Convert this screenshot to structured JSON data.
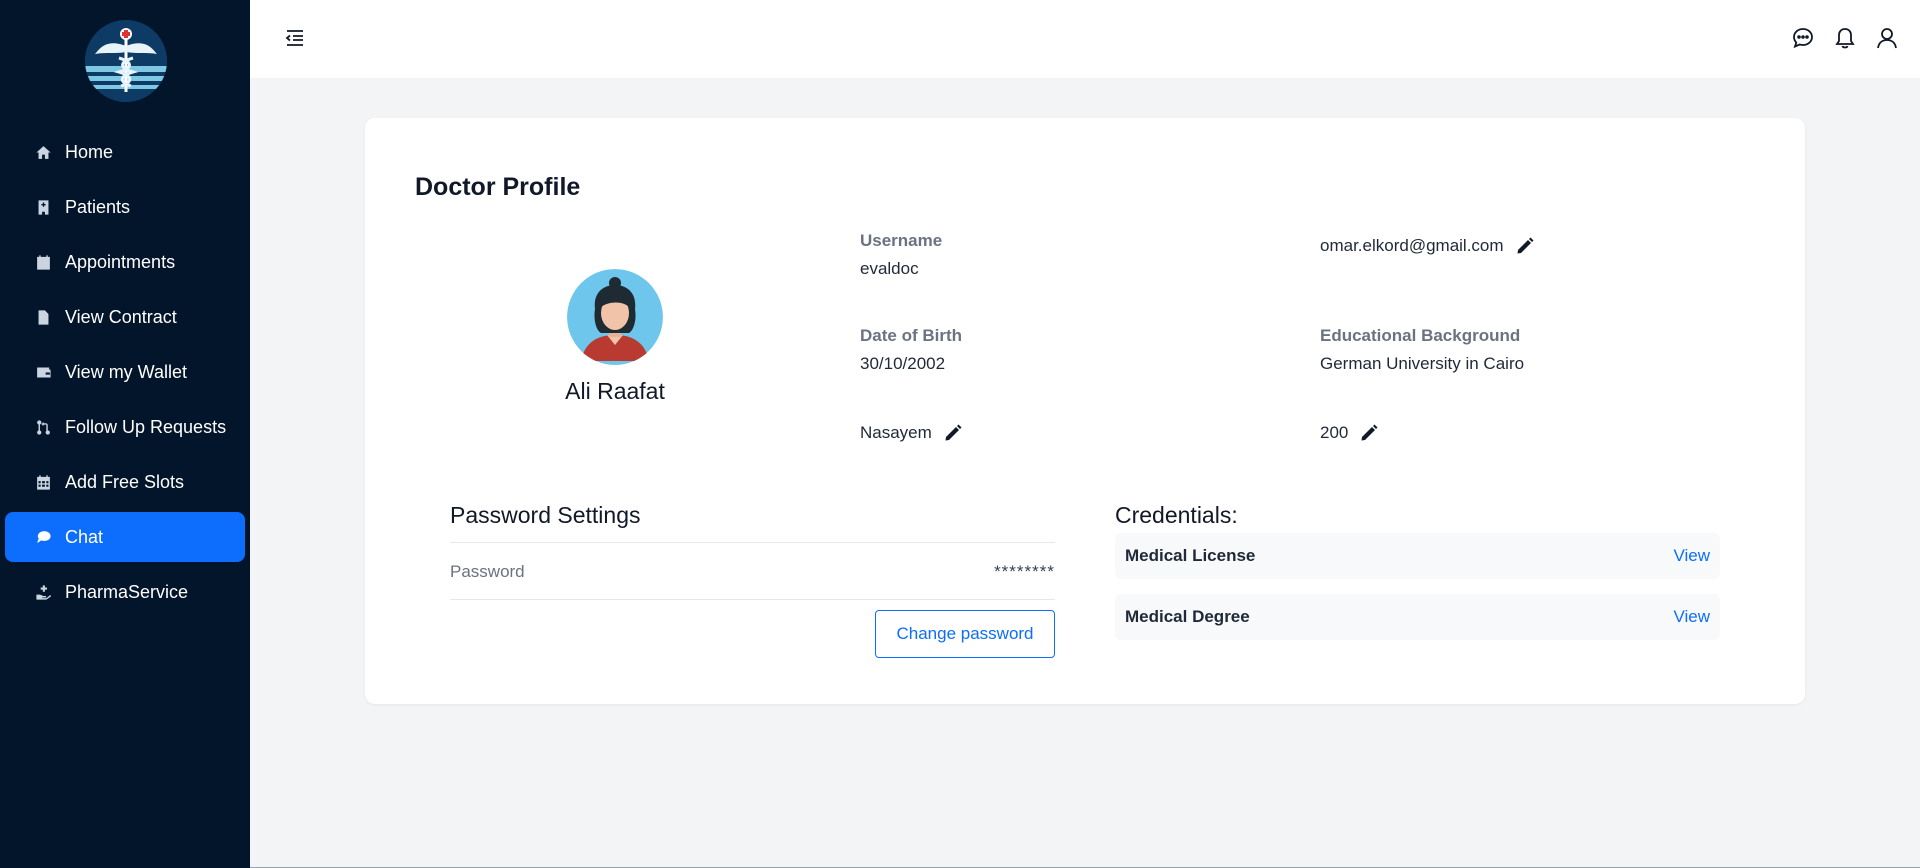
{
  "sidebar": {
    "items": [
      {
        "label": "Home",
        "icon": "home-icon"
      },
      {
        "label": "Patients",
        "icon": "hospital-icon"
      },
      {
        "label": "Appointments",
        "icon": "calendar-icon"
      },
      {
        "label": "View Contract",
        "icon": "file-contract-icon"
      },
      {
        "label": "View my Wallet",
        "icon": "wallet-icon"
      },
      {
        "label": "Follow Up Requests",
        "icon": "code-pull-request-icon"
      },
      {
        "label": "Add Free Slots",
        "icon": "calendar-grid-icon"
      },
      {
        "label": "Chat",
        "icon": "chat-icon",
        "active": true
      },
      {
        "label": "PharmaService",
        "icon": "hand-holding-medical-icon"
      }
    ],
    "active_color": "#0d6efd",
    "background": "#03152b"
  },
  "topbar": {
    "icons": [
      "menu-collapse-icon",
      "chat-dots-icon",
      "bell-icon",
      "user-icon"
    ]
  },
  "profile": {
    "title": "Doctor Profile",
    "name": "Ali Raafat",
    "username_label": "Username",
    "username": "evaldoc",
    "email": "omar.elkord@gmail.com",
    "dob_label": "Date of Birth",
    "dob": "30/10/2002",
    "education_label": "Educational Background",
    "education": "German University in Cairo",
    "affiliation": "Nasayem",
    "rate": "200"
  },
  "password": {
    "title": "Password Settings",
    "label": "Password",
    "value": "********",
    "button": "Change password"
  },
  "credentials": {
    "title": "Credentials:",
    "items": [
      {
        "name": "Medical License",
        "action": "View"
      },
      {
        "name": "Medical Degree",
        "action": "View"
      }
    ]
  }
}
